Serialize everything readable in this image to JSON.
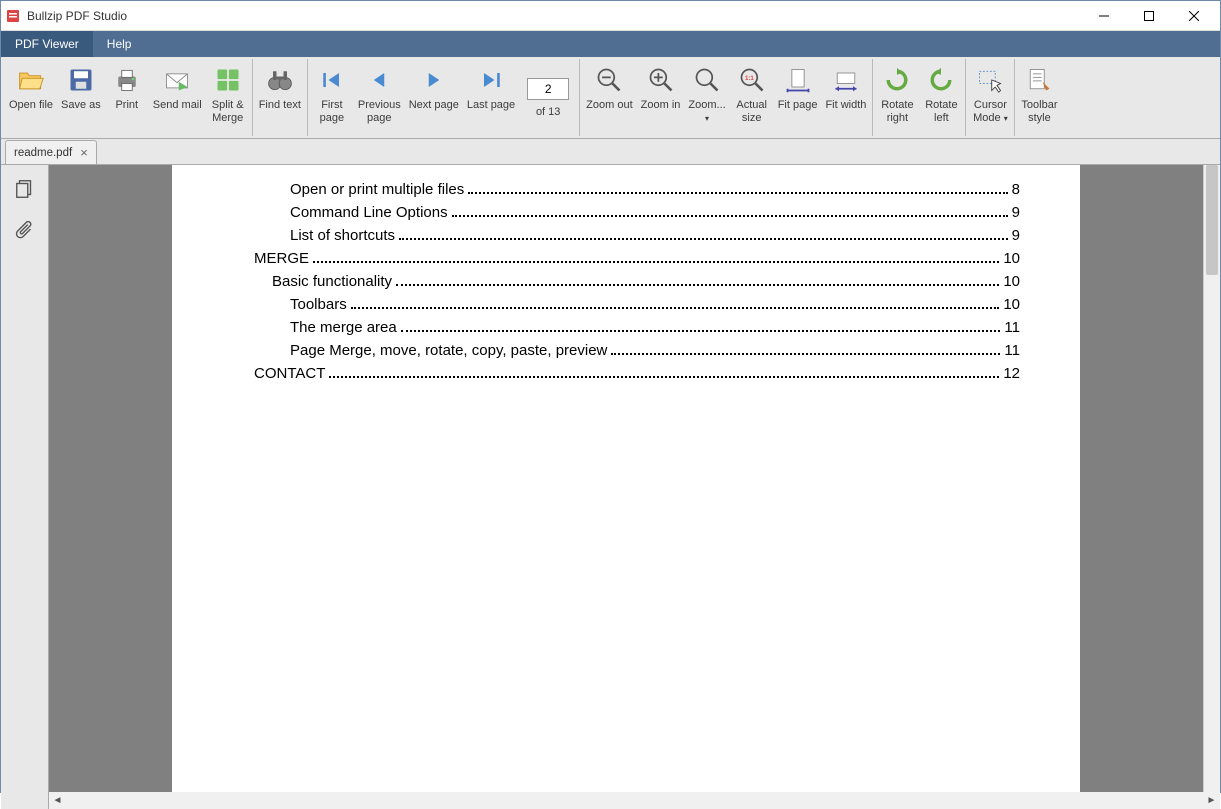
{
  "app": {
    "title": "Bullzip PDF Studio"
  },
  "menu": {
    "viewer": "PDF Viewer",
    "help": "Help"
  },
  "toolbar": {
    "open": "Open file",
    "save": "Save as",
    "print": "Print",
    "sendmail": "Send mail",
    "split": "Split &\nMerge",
    "findtext": "Find text",
    "firstpage": "First\npage",
    "prevpage": "Previous\npage",
    "nextpage": "Next page",
    "lastpage": "Last page",
    "page_current": "2",
    "page_total": "of 13",
    "zoomout": "Zoom out",
    "zoomin": "Zoom in",
    "zoom": "Zoom...",
    "actualsize": "Actual\nsize",
    "fitpage": "Fit page",
    "fitwidth": "Fit width",
    "rotateright": "Rotate\nright",
    "rotateleft": "Rotate\nleft",
    "cursormode": "Cursor\nMode",
    "toolbarstyle": "Toolbar\nstyle"
  },
  "tab": {
    "filename": "readme.pdf"
  },
  "toc": [
    {
      "level": 3,
      "text": "Open or print multiple files",
      "page": "8"
    },
    {
      "level": 3,
      "text": "Command Line Options",
      "page": "9"
    },
    {
      "level": 3,
      "text": "List of shortcuts",
      "page": "9"
    },
    {
      "level": 1,
      "text": "MERGE",
      "page": "10"
    },
    {
      "level": 2,
      "text": "Basic functionality",
      "page": "10"
    },
    {
      "level": 3,
      "text": "Toolbars",
      "page": "10"
    },
    {
      "level": 3,
      "text": "The merge area",
      "page": "11"
    },
    {
      "level": 3,
      "text": "Page Merge, move, rotate, copy, paste, preview",
      "page": "11"
    },
    {
      "level": 1,
      "text": "CONTACT",
      "page": "12"
    }
  ]
}
